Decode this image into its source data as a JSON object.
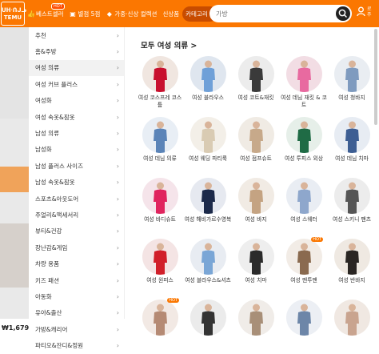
{
  "logo": {
    "line1": "ᑌᕼᐧᑎᒍᓗ",
    "line2": "TEMU"
  },
  "nav": [
    {
      "icon": "thumbs-up-icon",
      "glyph": "👍",
      "label": "베스트셀러",
      "badge": "HOT"
    },
    {
      "icon": "store-icon",
      "glyph": "▣",
      "label": "별점 5점",
      "badge": ""
    },
    {
      "icon": "tag-icon",
      "glyph": "◆",
      "label": "가중·신상 컬렉션",
      "badge": ""
    },
    {
      "icon": "",
      "glyph": "",
      "label": "신상품",
      "badge": ""
    }
  ],
  "category_button": {
    "label": "카테고리",
    "chevron": "⌃"
  },
  "search": {
    "placeholder": "가방"
  },
  "user": {
    "line1": "로",
    "line2": "주"
  },
  "menu": [
    {
      "label": "추천",
      "active": false
    },
    {
      "label": "홈&주방",
      "active": false
    },
    {
      "label": "여성 의류",
      "active": true
    },
    {
      "label": "여성 커브 플러스",
      "active": false
    },
    {
      "label": "여성화",
      "active": false
    },
    {
      "label": "여성 속옷&잠옷",
      "active": false
    },
    {
      "label": "남성 의류",
      "active": false
    },
    {
      "label": "남성화",
      "active": false
    },
    {
      "label": "남성 플러스 사이즈",
      "active": false
    },
    {
      "label": "남성 속옷&잠옷",
      "active": false
    },
    {
      "label": "스포츠&아웃도어",
      "active": false
    },
    {
      "label": "주얼리&액세서리",
      "active": false
    },
    {
      "label": "뷰티&건강",
      "active": false
    },
    {
      "label": "장난감&게임",
      "active": false
    },
    {
      "label": "차량 용품",
      "active": false
    },
    {
      "label": "키즈 패션",
      "active": false
    },
    {
      "label": "아동화",
      "active": false
    },
    {
      "label": "유아&출산",
      "active": false
    },
    {
      "label": "가방&캐리어",
      "active": false
    },
    {
      "label": "파티오&잔디&정원",
      "active": false
    }
  ],
  "panel": {
    "title": "모두 여성 의류 >"
  },
  "products": [
    {
      "label": "여성 코스프레 코스튬",
      "bg": "#f0e6e0",
      "color": "#c8102e",
      "hot": ""
    },
    {
      "label": "여성 블라우스",
      "bg": "#dfe6ef",
      "color": "#6fa0d8",
      "hot": ""
    },
    {
      "label": "여성 코트&재킷",
      "bg": "#ececec",
      "color": "#3a3a3a",
      "hot": ""
    },
    {
      "label": "여성 데님 재킷 & 코트",
      "bg": "#f2dde4",
      "color": "#e86aa0",
      "hot": ""
    },
    {
      "label": "여성 청바지",
      "bg": "#e9edf2",
      "color": "#7f9bbf",
      "hot": ""
    },
    {
      "label": "여성 데님 의류",
      "bg": "#e8eef5",
      "color": "#5b84b8",
      "hot": ""
    },
    {
      "label": "여성 웨딩 파티룩",
      "bg": "#f3efe8",
      "color": "#d9cbb3",
      "hot": ""
    },
    {
      "label": "여성 점프슈트",
      "bg": "#f0ebe4",
      "color": "#c7a98a",
      "hot": ""
    },
    {
      "label": "여성 투피스 외상",
      "bg": "#e6efe9",
      "color": "#1f6b45",
      "hot": ""
    },
    {
      "label": "여성 데님 치마",
      "bg": "#e7ecf3",
      "color": "#3d5e93",
      "hot": ""
    },
    {
      "label": "여성 바디슈트",
      "bg": "#f5e4ea",
      "color": "#e0245e",
      "hot": ""
    },
    {
      "label": "여성 해비가르수영복",
      "bg": "#e6e9f0",
      "color": "#1c2a4a",
      "hot": ""
    },
    {
      "label": "여성 바지",
      "bg": "#f1ebe4",
      "color": "#c4a382",
      "hot": ""
    },
    {
      "label": "여성 스웨터",
      "bg": "#e9edf3",
      "color": "#8ea7cc",
      "hot": ""
    },
    {
      "label": "여성 스키니 팬츠",
      "bg": "#ececec",
      "color": "#555555",
      "hot": ""
    },
    {
      "label": "여성 원피스",
      "bg": "#f4e4e4",
      "color": "#d11f2a",
      "hot": ""
    },
    {
      "label": "여성 블라우스&셔츠",
      "bg": "#e8ecf2",
      "color": "#7aa6d6",
      "hot": ""
    },
    {
      "label": "여성 치마",
      "bg": "#eeeeee",
      "color": "#2b2b2b",
      "hot": ""
    },
    {
      "label": "여성 맨투맨",
      "bg": "#f2ece6",
      "color": "#8a6a4f",
      "hot": "HOT"
    },
    {
      "label": "여성 반바지",
      "bg": "#efe9e2",
      "color": "#2a2623",
      "hot": ""
    },
    {
      "label": "",
      "bg": "#f2e9e4",
      "color": "#b58a74",
      "hot": "HOT"
    },
    {
      "label": "",
      "bg": "#ebebeb",
      "color": "#333333",
      "hot": ""
    },
    {
      "label": "",
      "bg": "#f0ece8",
      "color": "#a88f78",
      "hot": ""
    },
    {
      "label": "",
      "bg": "#eceff4",
      "color": "#6d86a8",
      "hot": ""
    },
    {
      "label": "",
      "bg": "#f0e8e2",
      "color": "#c9a48f",
      "hot": ""
    }
  ],
  "background": {
    "price": "₩1,679"
  }
}
